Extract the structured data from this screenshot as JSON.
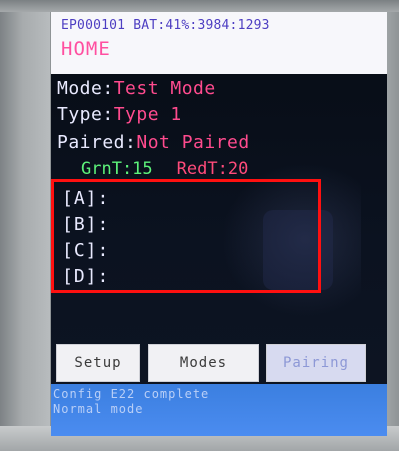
{
  "header": {
    "status_line": "EP000101 BAT:41%:3984:1293",
    "title": "HOME"
  },
  "info": {
    "mode_label": "Mode:",
    "mode_value": "Test Mode",
    "type_label": "Type:",
    "type_value": "Type 1",
    "paired_label": "Paired:",
    "paired_value": "Not Paired",
    "green_timer": "GrnT:15",
    "red_timer": "RedT:20"
  },
  "channels": {
    "a": "[A]:",
    "b": "[B]:",
    "c": "[C]:",
    "d": "[D]:"
  },
  "buttons": {
    "setup": "Setup",
    "modes": "Modes",
    "pairing": "Pairing"
  },
  "console": {
    "line1": "Config E22 complete",
    "line2": "Normal mode"
  },
  "colors": {
    "highlight_box": "#ff1010",
    "value_text": "#ff4b8e",
    "green_timer": "#5df27a",
    "console_bg": "#4b8cf0"
  }
}
